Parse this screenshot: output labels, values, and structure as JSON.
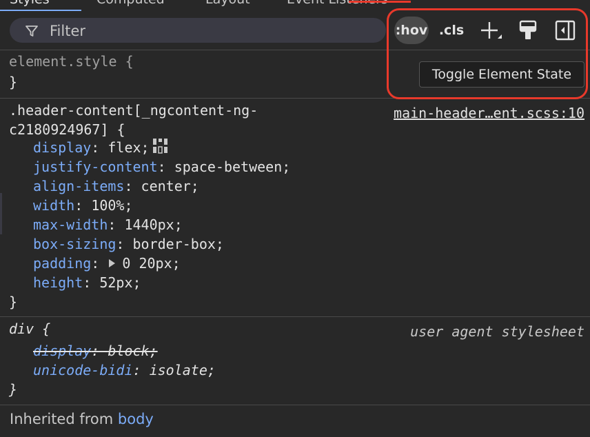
{
  "tabs": [
    {
      "label": "Styles",
      "active": true
    },
    {
      "label": "Computed",
      "active": false
    },
    {
      "label": "Layout",
      "active": false
    },
    {
      "label": "Event Listeners",
      "active": false
    }
  ],
  "toolbar": {
    "filter_placeholder": "Filter",
    "hov_label": ":hov",
    "cls_label": ".cls",
    "tooltip": "Toggle Element State"
  },
  "rules": {
    "element_style": {
      "selector": "element.style {",
      "close": "}"
    },
    "header_content": {
      "selector_line1": ".header-content[_ngcontent-ng-",
      "selector_line2": "c2180924967] {",
      "source": "main-header…ent.scss:10",
      "declarations": [
        {
          "prop": "display",
          "value": "flex;"
        },
        {
          "prop": "justify-content",
          "value": "space-between;"
        },
        {
          "prop": "align-items",
          "value": "center;"
        },
        {
          "prop": "width",
          "value": "100%;"
        },
        {
          "prop": "max-width",
          "value": "1440px;"
        },
        {
          "prop": "box-sizing",
          "value": "border-box;"
        },
        {
          "prop": "padding",
          "value": "0 20px;"
        },
        {
          "prop": "height",
          "value": "52px;"
        }
      ],
      "close": "}"
    },
    "div_ua": {
      "selector": "div {",
      "source": "user agent stylesheet",
      "declarations": [
        {
          "prop": "display",
          "value": "block;"
        },
        {
          "prop": "unicode-bidi",
          "value": "isolate;"
        }
      ],
      "close": "}"
    }
  },
  "inherited": {
    "prefix": "Inherited from ",
    "element": "body"
  },
  "colors": {
    "background": "#282828",
    "property": "#7cacf8",
    "annotation": "#e8392b"
  }
}
